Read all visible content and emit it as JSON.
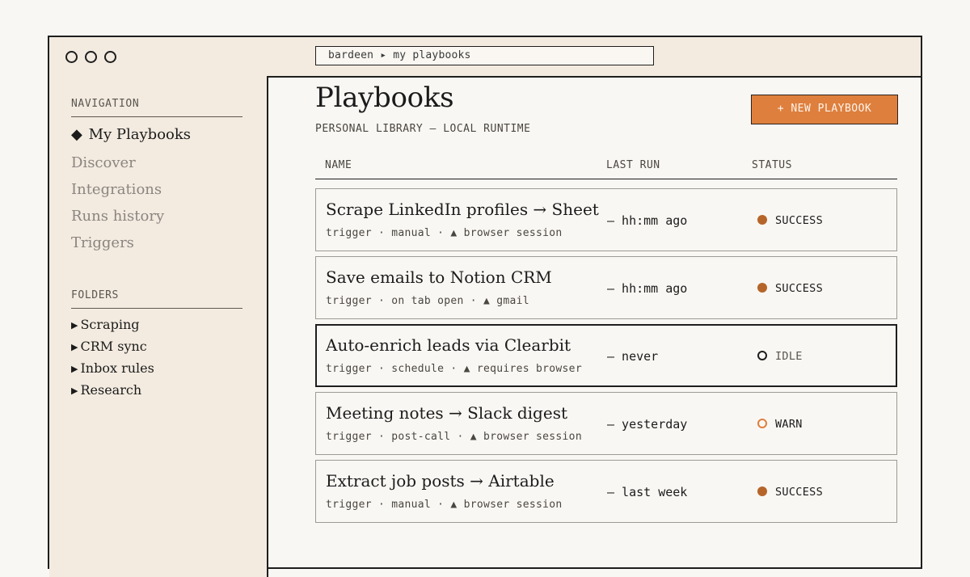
{
  "window": {
    "address": "bardeen ▸ my playbooks"
  },
  "sidebar": {
    "navigation_heading": "NAVIGATION",
    "nav_items": [
      {
        "label": "My Playbooks",
        "marker": "◆",
        "active": true
      },
      {
        "label": "Discover",
        "active": false
      },
      {
        "label": "Integrations",
        "active": false
      },
      {
        "label": "Runs history",
        "active": false
      },
      {
        "label": "Triggers",
        "active": false
      }
    ],
    "folders_heading": "FOLDERS",
    "folder_marker": "▶",
    "folders": [
      {
        "label": "Scraping"
      },
      {
        "label": "CRM sync"
      },
      {
        "label": "Inbox rules"
      },
      {
        "label": "Research"
      }
    ]
  },
  "main": {
    "title": "Playbooks",
    "subtitle": "PERSONAL LIBRARY — LOCAL RUNTIME",
    "new_button": "+ NEW PLAYBOOK",
    "columns": {
      "name": "NAME",
      "last_run": "LAST RUN",
      "status": "STATUS"
    },
    "rows": [
      {
        "title": "Scrape LinkedIn profiles → Sheet",
        "meta": "trigger · manual · ▲ browser session",
        "last_run": "— hh:mm ago",
        "status": "SUCCESS",
        "status_kind": "success",
        "selected": false
      },
      {
        "title": "Save emails to Notion CRM",
        "meta": "trigger · on tab open · ▲ gmail",
        "last_run": "— hh:mm ago",
        "status": "SUCCESS",
        "status_kind": "success",
        "selected": false
      },
      {
        "title": "Auto-enrich leads via Clearbit",
        "meta": "trigger · schedule · ▲ requires browser",
        "last_run": "— never",
        "status": "IDLE",
        "status_kind": "idle",
        "selected": true
      },
      {
        "title": "Meeting notes → Slack digest",
        "meta": "trigger · post-call · ▲ browser session",
        "last_run": "— yesterday",
        "status": "WARN",
        "status_kind": "warn",
        "selected": false
      },
      {
        "title": "Extract job posts → Airtable",
        "meta": "trigger · manual · ▲ browser session",
        "last_run": "— last week",
        "status": "SUCCESS",
        "status_kind": "success",
        "selected": false
      }
    ]
  },
  "colors": {
    "accent": "#de7f3d",
    "success": "#b6652a",
    "sidebar_bg": "#f3ebe0",
    "page_bg": "#f9f7f3"
  }
}
